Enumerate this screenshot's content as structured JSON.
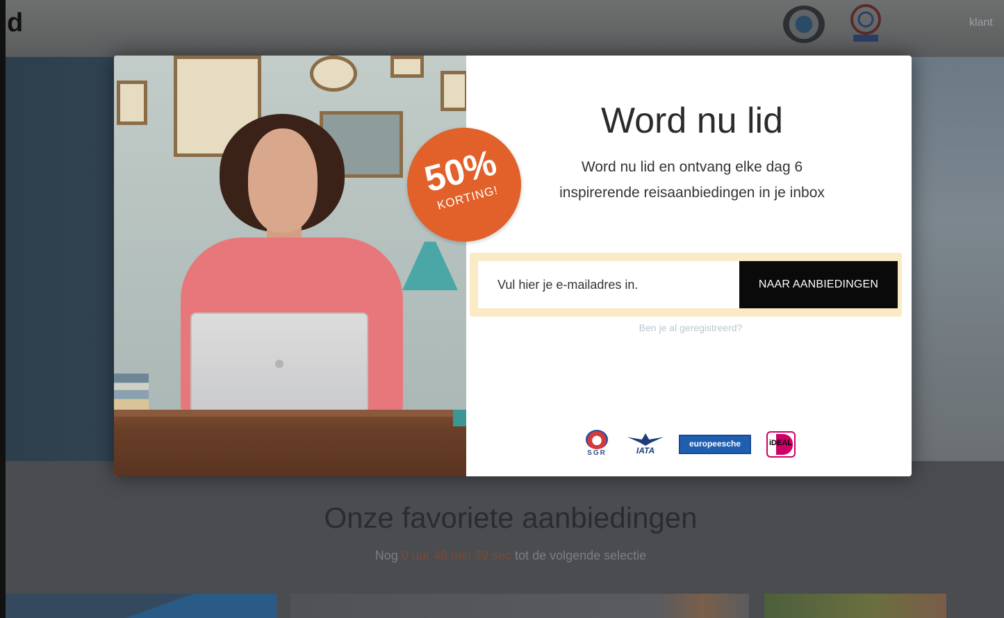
{
  "header": {
    "logo_letter": "d",
    "nav_text": "klant",
    "icons": [
      "globe-icon",
      "sgr-logo"
    ]
  },
  "modal": {
    "title": "Word nu lid",
    "subtitle_line1": "Word nu lid en ontvang elke dag 6",
    "subtitle_line2": "inspirerende reisaanbiedingen in je inbox",
    "badge_percent": "50%",
    "badge_text": "KORTING!",
    "email_placeholder": "Vul hier je e-mailadres in.",
    "submit_label": "NAAR AANBIEDINGEN",
    "registered_link": "Ben je al geregistreerd?",
    "trust_logos": {
      "sgr": "SGR",
      "iata": "IATA",
      "europeesche": "europeesche",
      "ideal": "iDEAL"
    }
  },
  "page": {
    "headline": "Onze favoriete aanbiedingen",
    "countdown": {
      "prefix": "Nog",
      "hours": "0",
      "hours_unit": "uur",
      "minutes": "46",
      "minutes_unit": "min",
      "seconds": "39",
      "seconds_unit": "sec",
      "suffix": "tot de volgende selectie"
    }
  },
  "colors": {
    "badge": "#e2602a",
    "button": "#0a0a0a",
    "form_highlight": "#fbeac6",
    "link": "#b9c7cd"
  }
}
